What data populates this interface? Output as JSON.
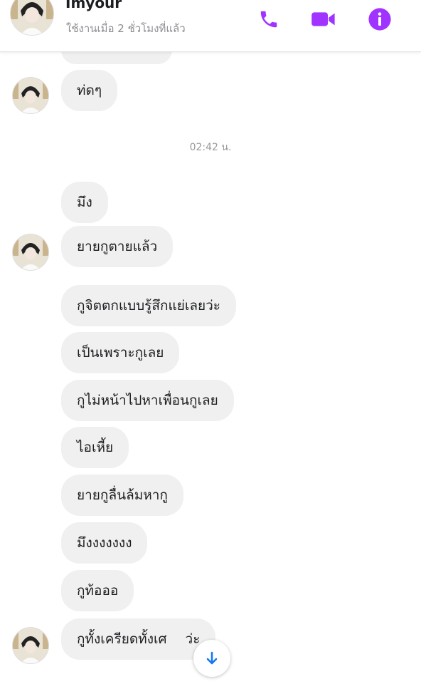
{
  "header": {
    "name": "Imyour",
    "status": "ใช้งานเมื่อ 2 ชั่วโมงที่แล้ว",
    "icons": [
      "phone-icon",
      "video-icon",
      "info-icon"
    ],
    "accent_color": "#a033ff"
  },
  "messages": [
    {
      "text": "ท่ดๆ"
    },
    {
      "text": "มึง"
    },
    {
      "text": "ยายกูตายแล้ว"
    },
    {
      "text": "กูจิตตกแบบรู้สึกแย่เลยว่ะ"
    },
    {
      "text": "เป็นเพราะกูเลย"
    },
    {
      "text": "กูไม่หน้าไปหาเพื่อนกูเลย"
    },
    {
      "text": "ไอเหี้ย"
    },
    {
      "text": "ยายกูลื่นล้มหากู"
    },
    {
      "text": "มึงงงงงงง"
    },
    {
      "text": "กูท้อออ"
    },
    {
      "text": "กูทั้งเครียดทั้งเศ"
    },
    {
      "text": "ว่ะ"
    }
  ],
  "timestamp": "02:42 น.",
  "bubble_color": "#f0f0f0"
}
